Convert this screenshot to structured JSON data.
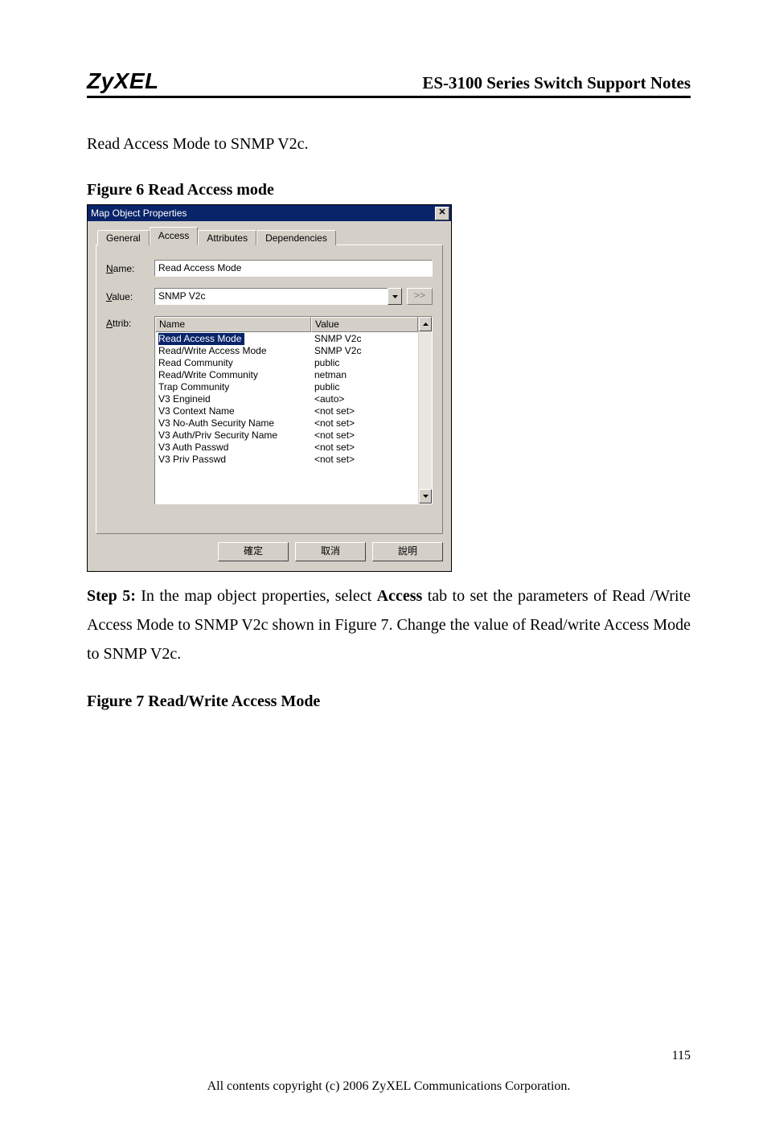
{
  "header": {
    "brand": "ZyXEL",
    "doc_title": "ES-3100 Series Switch Support Notes"
  },
  "intro_line": "Read Access Mode to SNMP V2c.",
  "figure6_caption": "Figure 6 Read Access mode",
  "dialog": {
    "title": "Map Object Properties",
    "close_glyph": "✕",
    "tabs": {
      "general": "General",
      "access": "Access",
      "attributes": "Attributes",
      "dependencies": "Dependencies"
    },
    "labels": {
      "name_prefix": "N",
      "name_rest": "ame:",
      "value_prefix": "V",
      "value_rest": "alue:",
      "attrib_prefix": "A",
      "attrib_rest": "ttrib:",
      "ext": ">>"
    },
    "name_value": "Read Access Mode",
    "value_value": "SNMP V2c",
    "columns": {
      "name": "Name",
      "value": "Value"
    },
    "attribs": [
      {
        "name": "Read Access Mode",
        "value": "SNMP V2c",
        "selected": true
      },
      {
        "name": "Read/Write Access Mode",
        "value": "SNMP V2c"
      },
      {
        "name": "Read Community",
        "value": "public"
      },
      {
        "name": "Read/Write Community",
        "value": "netman"
      },
      {
        "name": "Trap Community",
        "value": "public"
      },
      {
        "name": "V3 Engineid",
        "value": "<auto>"
      },
      {
        "name": "V3 Context Name",
        "value": "<not set>"
      },
      {
        "name": "V3 No-Auth Security Name",
        "value": "<not set>"
      },
      {
        "name": "V3 Auth/Priv Security Name",
        "value": "<not set>"
      },
      {
        "name": "V3 Auth Passwd",
        "value": "<not set>"
      },
      {
        "name": "V3 Priv Passwd",
        "value": "<not set>"
      }
    ],
    "buttons": {
      "ok": "確定",
      "cancel": "取消",
      "help": "說明"
    }
  },
  "step5": {
    "label": "Step 5:",
    "body": " In the map object properties, select ",
    "bold_mid": "Access",
    "body2": " tab to set the parameters of Read /Write Access Mode to SNMP V2c shown in Figure 7. Change the value of Read/write Access Mode to SNMP V2c."
  },
  "figure7_caption": "Figure 7 Read/Write Access Mode",
  "footer": {
    "page": "115",
    "copyright": "All contents copyright (c) 2006 ZyXEL Communications Corporation."
  }
}
